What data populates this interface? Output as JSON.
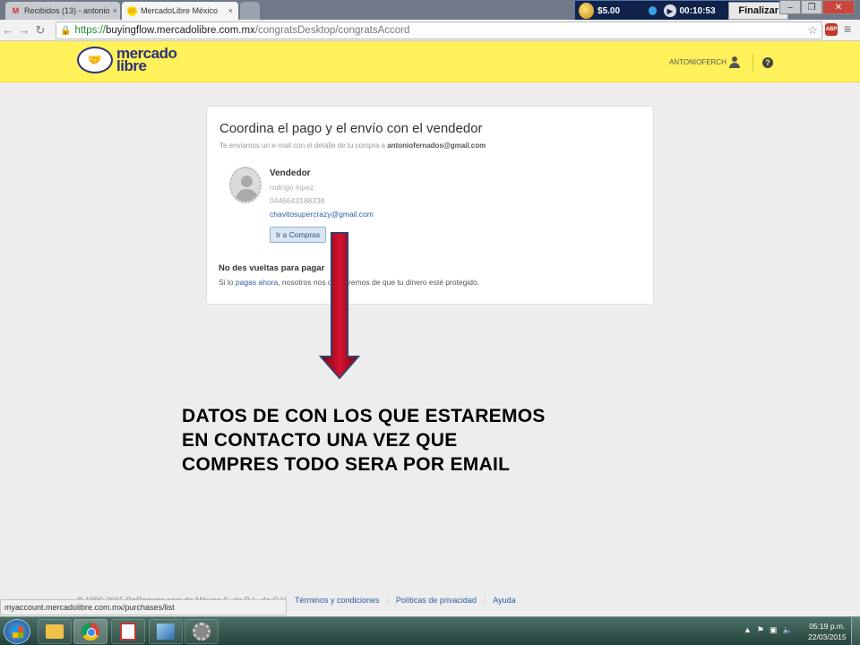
{
  "browser": {
    "tabs": [
      {
        "label": "Recibidos (13) - antonio",
        "favicon": "gmail-icon",
        "active": false
      },
      {
        "label": "MercadoLibre México",
        "favicon": "mercadolibre-icon",
        "active": true
      }
    ],
    "tab_close": "×",
    "url_scheme": "https://",
    "url_domain": "buyingflow.mercadolibre.com.mx",
    "url_path": "/congratsDesktop/congratsAccord",
    "adblock_label": "ABP"
  },
  "timer_widget": {
    "money": "$5.00",
    "time": "00:10:53",
    "finish_label": "Finalizar"
  },
  "site": {
    "brand_line1": "mercado",
    "brand_line2": "libre",
    "username": "ANTONIOFERCH",
    "help_glyph": "?",
    "colors": {
      "header": "#fff159",
      "brand": "#2d3277",
      "link": "#2d5aa8"
    }
  },
  "card": {
    "title": "Coordina el pago y el envío con el vendedor",
    "subtitle_prefix": "Te enviamos un e-mail con el detalle de tu compra a ",
    "subtitle_email": "antoniofernados@gmail.com",
    "seller_heading": "Vendedor",
    "seller_name": "rodrigo lopez.",
    "seller_phone": "0446643188338",
    "seller_email": "chavitosupercrazy@gmail.com",
    "compras_button": "Ir a Compras",
    "info_heading": "No des vueltas para pagar",
    "info_prefix": "Si lo ",
    "info_link": "pagas ahora",
    "info_suffix": ", nosotros nos ocuparemos de que tu dinero esté protegido."
  },
  "annotation": {
    "line1": "DATOS DE CON LOS QUE ESTAREMOS",
    "line2": "EN CONTACTO UNA VEZ QUE",
    "line3": "COMPRES TODO SERA POR EMAIL",
    "arrow_color": "#c8102e"
  },
  "footer": {
    "copyright": "© 1999-2015 DeRemate.com de México S. de R.L. de C.V.",
    "links": [
      "Términos y condiciones",
      "Políticas de privacidad",
      "Ayuda"
    ]
  },
  "status_url": "myaccount.mercadolibre.com.mx/purchases/list",
  "taskbar": {
    "clock_time": "05:19 p.m.",
    "clock_date": "22/03/2015"
  }
}
